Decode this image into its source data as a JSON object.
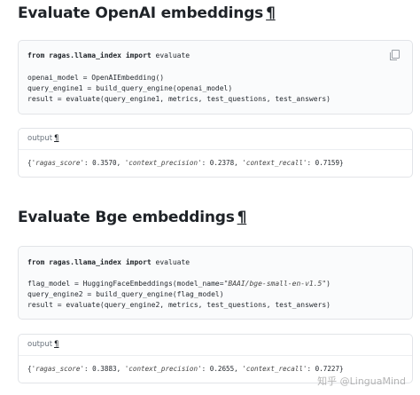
{
  "sections": [
    {
      "heading": "Evaluate OpenAI embeddings",
      "anchor": "¶",
      "code": {
        "import_line": {
          "kw1": "from",
          "module": "ragas.llama_index",
          "kw2": "import",
          "name": "evaluate"
        },
        "lines": [
          "openai_model = OpenAIEmbedding()",
          "query_engine1 = build_query_engine(openai_model)",
          "result = evaluate(query_engine1, metrics, test_questions, test_answers)"
        ]
      },
      "output": {
        "label": "output",
        "anchor": "¶",
        "text_parts": [
          "{",
          "'ragas_score'",
          ": 0.3570, ",
          "'context_precision'",
          ": 0.2378, ",
          "'context_recall'",
          ": 0.7159}"
        ]
      }
    },
    {
      "heading": "Evaluate Bge embeddings",
      "anchor": "¶",
      "code": {
        "import_line": {
          "kw1": "from",
          "module": "ragas.llama_index",
          "kw2": "import",
          "name": "evaluate"
        },
        "line1_prefix": "flag_model = HuggingFaceEmbeddings(model_name=",
        "line1_str": "\"BAAI/bge-small-en-v1.5\"",
        "line1_suffix": ")",
        "lines": [
          "query_engine2 = build_query_engine(flag_model)",
          "result = evaluate(query_engine2, metrics, test_questions, test_answers)"
        ]
      },
      "output": {
        "label": "output",
        "anchor": "¶",
        "text_parts": [
          "{",
          "'ragas_score'",
          ": 0.3883, ",
          "'context_precision'",
          ": 0.2655, ",
          "'context_recall'",
          ": 0.7227}"
        ]
      }
    }
  ],
  "watermark": "知乎 @LinguaMind",
  "icons": {
    "copy": "copy-icon"
  }
}
